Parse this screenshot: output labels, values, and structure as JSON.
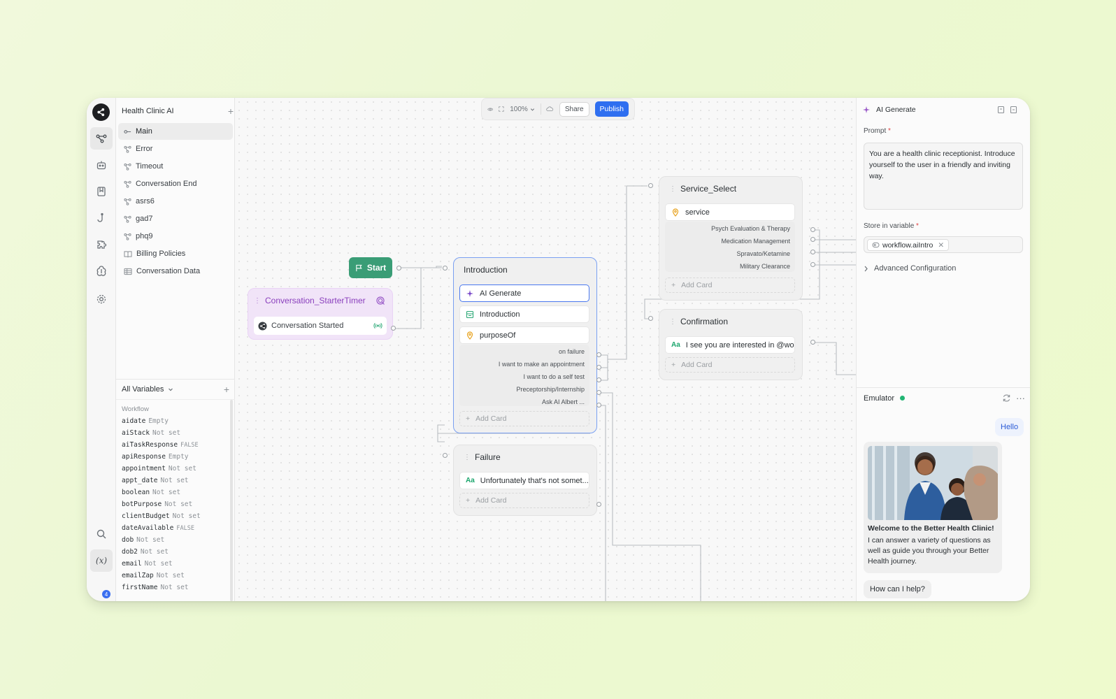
{
  "project": {
    "name": "Health Clinic AI"
  },
  "nav": [
    {
      "label": "Main",
      "active": true
    },
    {
      "label": "Error"
    },
    {
      "label": "Timeout"
    },
    {
      "label": "Conversation End"
    },
    {
      "label": "asrs6"
    },
    {
      "label": "gad7"
    },
    {
      "label": "phq9"
    },
    {
      "label": "Billing Policies"
    },
    {
      "label": "Conversation Data"
    }
  ],
  "variables": {
    "header": "All Variables",
    "group": "Workflow",
    "items": [
      {
        "name": "aidate",
        "value": "Empty"
      },
      {
        "name": "aiStack",
        "value": "Not set"
      },
      {
        "name": "aiTaskResponse",
        "value": "FALSE"
      },
      {
        "name": "apiResponse",
        "value": "Empty"
      },
      {
        "name": "appointment",
        "value": "Not set"
      },
      {
        "name": "appt_date",
        "value": "Not set"
      },
      {
        "name": "boolean",
        "value": "Not set"
      },
      {
        "name": "botPurpose",
        "value": "Not set"
      },
      {
        "name": "clientBudget",
        "value": "Not set"
      },
      {
        "name": "dateAvailable",
        "value": "FALSE"
      },
      {
        "name": "dob",
        "value": "Not set"
      },
      {
        "name": "dob2",
        "value": "Not set"
      },
      {
        "name": "email",
        "value": "Not set"
      },
      {
        "name": "emailZap",
        "value": "Not set"
      },
      {
        "name": "firstName",
        "value": "Not set"
      }
    ]
  },
  "rail": {
    "badge_count": "4",
    "var_icon": "(x)"
  },
  "toolbar": {
    "zoom": "100%",
    "share": "Share",
    "publish": "Publish"
  },
  "canvas": {
    "start_label": "Start",
    "timer": {
      "title": "Conversation_StarterTimer",
      "card": "Conversation Started"
    },
    "introduction": {
      "title": "Introduction",
      "cards": [
        "AI Generate",
        "Introduction",
        "purposeOf"
      ],
      "choices": [
        "on failure",
        "I want to make an appointment",
        "I want to do a self test",
        "Preceptorship/Internship",
        "Ask AI Albert ..."
      ],
      "add_card": "Add Card"
    },
    "service_select": {
      "title": "Service_Select",
      "card": "service",
      "choices": [
        "Psych Evaluation & Therapy",
        "Medication Management",
        "Spravato/Ketamine",
        "Military Clearance"
      ],
      "add_card": "Add Card"
    },
    "confirmation": {
      "title": "Confirmation",
      "card": "I see you are interested in @wo...",
      "add_card": "Add Card"
    },
    "failure": {
      "title": "Failure",
      "card": "Unfortunately that's not somet...",
      "add_card": "Add Card"
    }
  },
  "panel": {
    "title": "AI Generate",
    "prompt_label": "Prompt",
    "prompt_text": "You are a health clinic receptionist. Introduce yourself to the user in a friendly and inviting way.",
    "store_label": "Store in variable",
    "store_value": "workflow.aiIntro",
    "advanced": "Advanced Configuration"
  },
  "emulator": {
    "title": "Emulator",
    "user_msg": "Hello",
    "bot_title": "Welcome to the Better Health Clinic!",
    "bot_text": "I can answer a variety of questions as well as guide you through your Better Health journey.",
    "bot_msg": "How can I help?"
  },
  "colors": {
    "publish": "#2f6ff0",
    "start": "#3a9d76",
    "timer": "#8a3fbd",
    "selected": "#4a78ef"
  }
}
